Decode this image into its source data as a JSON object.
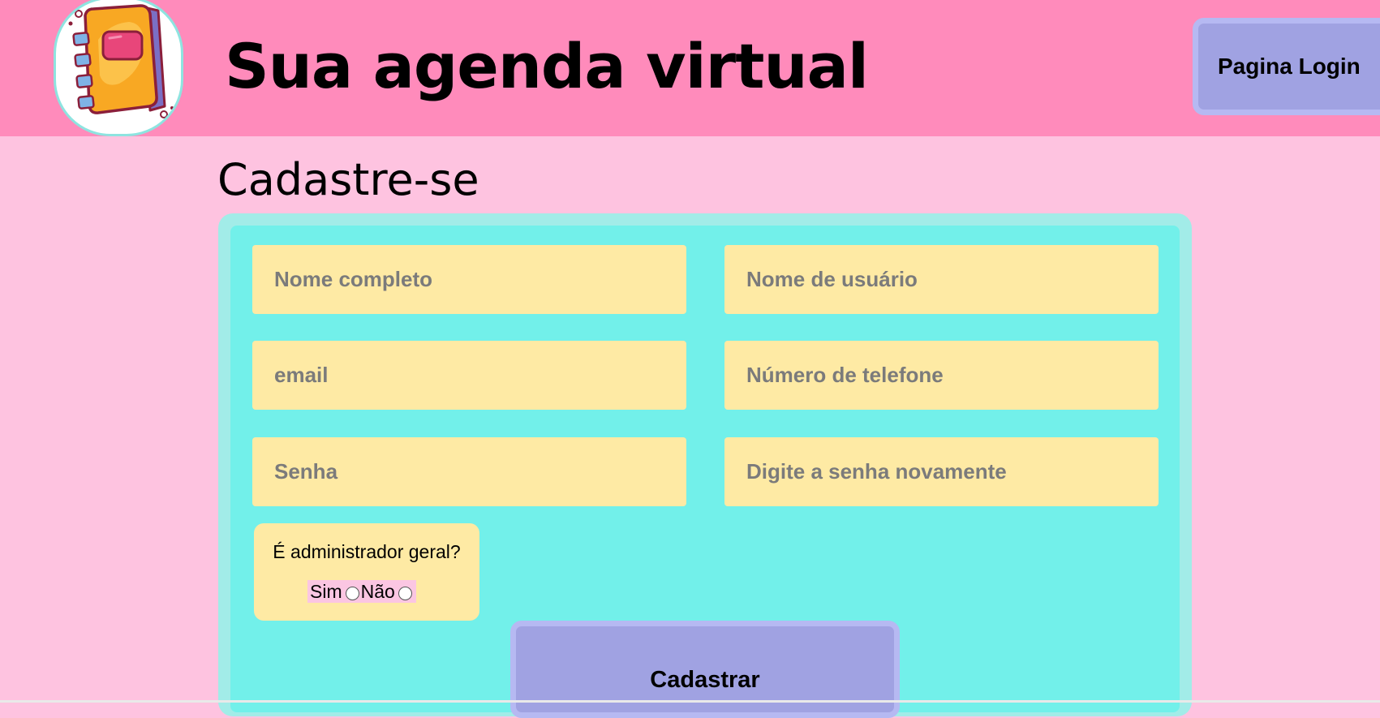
{
  "header": {
    "title": "Sua agenda virtual",
    "login_button": "Pagina Login",
    "logo_icon": "notebook-agenda-icon"
  },
  "main": {
    "heading": "Cadastre-se",
    "fields": {
      "full_name_placeholder": "Nome completo",
      "username_placeholder": "Nome de usuário",
      "email_placeholder": "email",
      "phone_placeholder": "Número de telefone",
      "password_placeholder": "Senha",
      "password_confirm_placeholder": "Digite a senha novamente"
    },
    "admin": {
      "question": "É administrador geral?",
      "yes_label": "Sim",
      "no_label": "Não"
    },
    "submit_label": "Cadastrar"
  },
  "colors": {
    "header_bg": "#ff8bbb",
    "page_bg": "#fec3e0",
    "form_bg": "#72f0ea",
    "field_bg": "#feeaa4",
    "button_bg": "#a0a2e2"
  }
}
